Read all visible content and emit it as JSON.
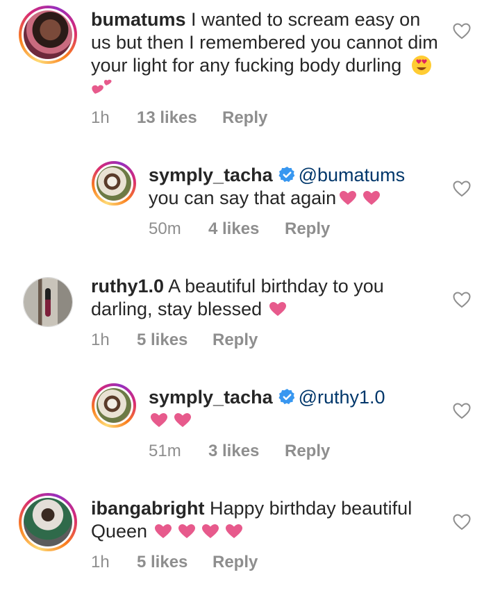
{
  "comments": [
    {
      "username": "bumatums",
      "text": "I wanted to scream easy on us but then I remembered you cannot dim your light for any fucking body durling",
      "emojis": [
        "smiling-face-with-heart-eyes",
        "two-hearts"
      ],
      "time": "1h",
      "likes": "13 likes",
      "reply": "Reply",
      "ring": true
    },
    {
      "username": "symply_tacha",
      "verified": true,
      "mention": "@bumatums",
      "text": "you can say that again",
      "emojis": [
        "heart",
        "heart"
      ],
      "time": "50m",
      "likes": "4 likes",
      "reply": "Reply",
      "ring": true
    },
    {
      "username": "ruthy1.0",
      "text": "A beautiful birthday to you darling, stay blessed",
      "emojis": [
        "heart"
      ],
      "time": "1h",
      "likes": "5 likes",
      "reply": "Reply",
      "ring": false
    },
    {
      "username": "symply_tacha",
      "verified": true,
      "mention": "@ruthy1.0",
      "text": "",
      "emojis": [
        "heart",
        "heart"
      ],
      "time": "51m",
      "likes": "3 likes",
      "reply": "Reply",
      "ring": true
    },
    {
      "username": "ibangabright",
      "text": "Happy birthday beautiful Queen",
      "emojis": [
        "heart",
        "heart",
        "heart",
        "heart"
      ],
      "time": "1h",
      "likes": "5 likes",
      "reply": "Reply",
      "ring": true
    }
  ],
  "colors": {
    "text": "#262626",
    "meta": "#8e8e8e",
    "mention": "#00376b",
    "verified": "#3897f0",
    "heart_emoji": "#e75a8c"
  },
  "icons": {
    "like": "heart-outline-icon",
    "verified": "verified-badge-icon"
  }
}
